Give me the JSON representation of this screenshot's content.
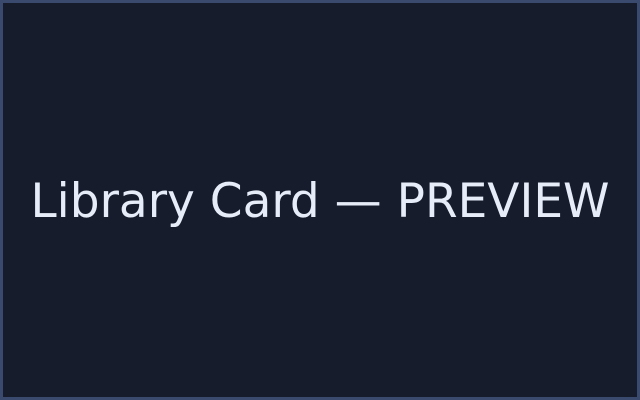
{
  "preview": {
    "title": "Library Card — PREVIEW"
  },
  "colors": {
    "background": "#161c2c",
    "border": "#3a4a6e",
    "text": "#e6ecf8"
  }
}
